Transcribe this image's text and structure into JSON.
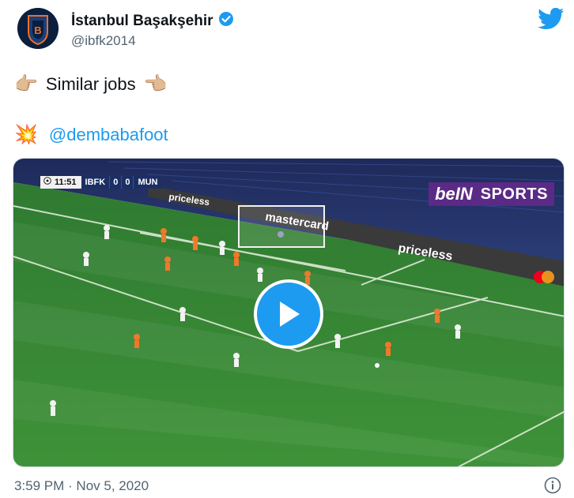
{
  "author": {
    "display_name": "İstanbul Başakşehir",
    "handle": "@ibfk2014",
    "verified": true,
    "avatar_icon": "club-crest-icon"
  },
  "tweet": {
    "line1_text": "Similar jobs",
    "line1_left_emoji": "👉🏼",
    "line1_right_emoji": "👈🏼",
    "line2_emoji": "💥",
    "mention": "@dembabafoot"
  },
  "video": {
    "scorebug": {
      "time": "11:51",
      "home": "IBFK",
      "home_score": "0",
      "away_score": "0",
      "away": "MUN"
    },
    "broadcaster_logo": "beIN",
    "broadcaster_sports": "SPORTS",
    "ads": [
      "priceless",
      "mastercard",
      "priceless"
    ],
    "play_icon": "play-icon"
  },
  "footer": {
    "timestamp": "3:59 PM · Nov 5, 2020"
  },
  "colors": {
    "accent": "#1d9bf0",
    "text": "#0f1419",
    "muted": "#536471",
    "pitch": "#3f8f3a"
  }
}
